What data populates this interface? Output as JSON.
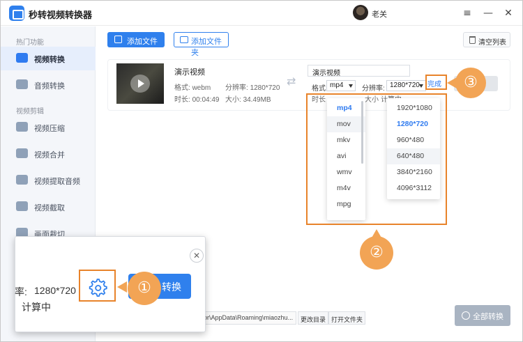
{
  "app": {
    "title": "秒转视频转换器",
    "user_name": "老关"
  },
  "window_controls": {
    "menu": "≡",
    "minimize": "—",
    "close": "✕"
  },
  "sidebar": {
    "group1": "热门功能",
    "group2": "视频剪辑",
    "items": [
      {
        "label": "视频转换",
        "icon": "video-convert-icon",
        "active": true
      },
      {
        "label": "音频转换",
        "icon": "audio-convert-icon",
        "active": false
      },
      {
        "label": "视频压缩",
        "icon": "video-compress-icon",
        "active": false
      },
      {
        "label": "视频合并",
        "icon": "video-merge-icon",
        "active": false
      },
      {
        "label": "视频提取音频",
        "icon": "extract-audio-icon",
        "active": false
      },
      {
        "label": "视频截取",
        "icon": "video-cut-icon",
        "active": false
      },
      {
        "label": "画面裁切",
        "icon": "crop-icon",
        "active": false
      }
    ]
  },
  "toolbar": {
    "add_file": "添加文件",
    "add_folder": "添加文件夹",
    "clear_list": "清空列表"
  },
  "file": {
    "name": "演示视频",
    "format_label": "格式: ",
    "format": "webm",
    "resolution_label": "分辨率: ",
    "resolution": "1280*720",
    "duration_label": "时长: ",
    "duration": "00:04:49",
    "size_label": "大小: ",
    "size": "34.49MB"
  },
  "output": {
    "name": "演示视频",
    "format_label": "格式:",
    "format": "mp4",
    "resolution_label": "分辨率:",
    "resolution": "1280*720",
    "duration_partial": "时长",
    "size_partial": "大小",
    "calc_partial": "计算中",
    "done": "完成"
  },
  "format_options": [
    "mp4",
    "mov",
    "mkv",
    "avi",
    "wmv",
    "m4v",
    "mpg"
  ],
  "format_selected": "mp4",
  "format_hover": "mov",
  "resolution_options": [
    "1920*1080",
    "1280*720",
    "960*480",
    "640*480",
    "3840*2160",
    "4096*3112"
  ],
  "resolution_selected": "1280*720",
  "resolution_hover": "640*480",
  "badges": {
    "one": "①",
    "two": "②",
    "three": "③"
  },
  "bottom": {
    "path": "or\\AppData\\Roaming\\miaozhu...",
    "change_dir": "更改目录",
    "open_folder": "打开文件夹",
    "convert_all": "全部转换"
  },
  "zoom": {
    "rate_label": "率:",
    "resolution": "1280*720",
    "status": "计算中",
    "convert": "转换",
    "close": "✕"
  },
  "colors": {
    "accent": "#2f80ed",
    "annotation": "#e8832a",
    "badge": "#f2a455"
  }
}
